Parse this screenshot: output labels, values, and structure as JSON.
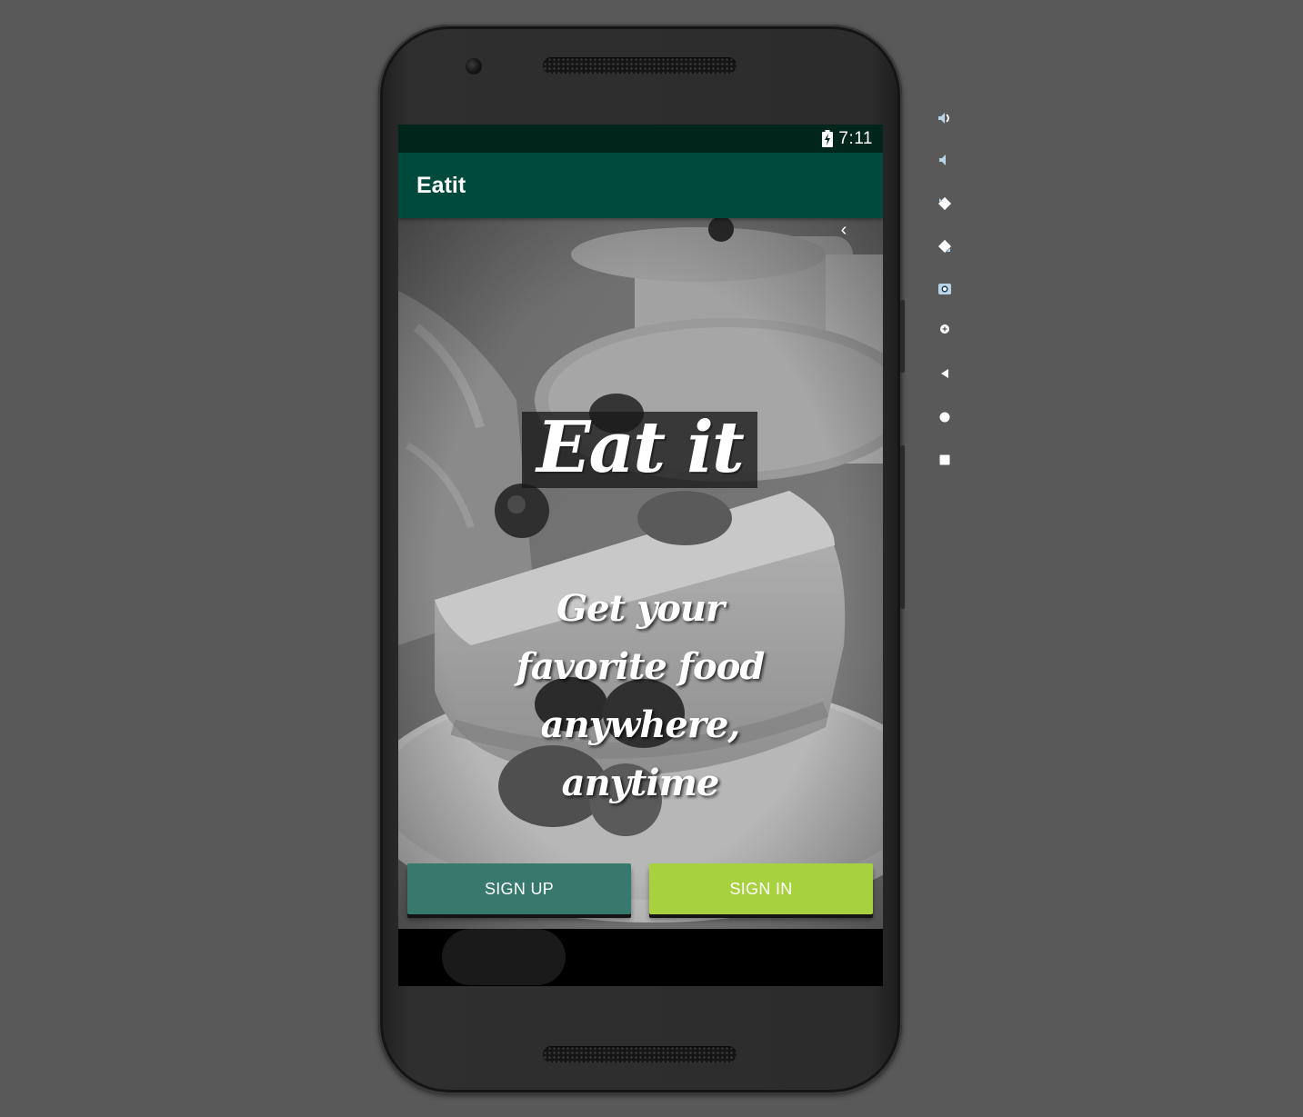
{
  "status_bar": {
    "time": "7:11",
    "battery_icon": "battery-charging-icon"
  },
  "app_bar": {
    "title": "Eatit"
  },
  "hero": {
    "back_icon": "chevron-left-icon",
    "back_glyph": "‹",
    "logo_text": "Eat it",
    "tagline": "Get your favorite food anywhere, anytime"
  },
  "buttons": {
    "sign_up": "SIGN UP",
    "sign_in": "SIGN IN"
  },
  "colors": {
    "status_bar": "#00261b",
    "app_bar": "#004a3d",
    "sign_up": "#38796d",
    "sign_in": "#a7d13f",
    "emulator_background": "#595959"
  },
  "emulator_toolbar": {
    "tools": [
      {
        "icon": "volume-up-icon"
      },
      {
        "icon": "volume-down-icon"
      },
      {
        "icon": "rotate-left-icon"
      },
      {
        "icon": "rotate-right-icon"
      },
      {
        "icon": "camera-icon"
      },
      {
        "icon": "zoom-icon"
      },
      {
        "icon": "back-icon"
      },
      {
        "icon": "home-icon"
      },
      {
        "icon": "overview-icon"
      }
    ]
  }
}
